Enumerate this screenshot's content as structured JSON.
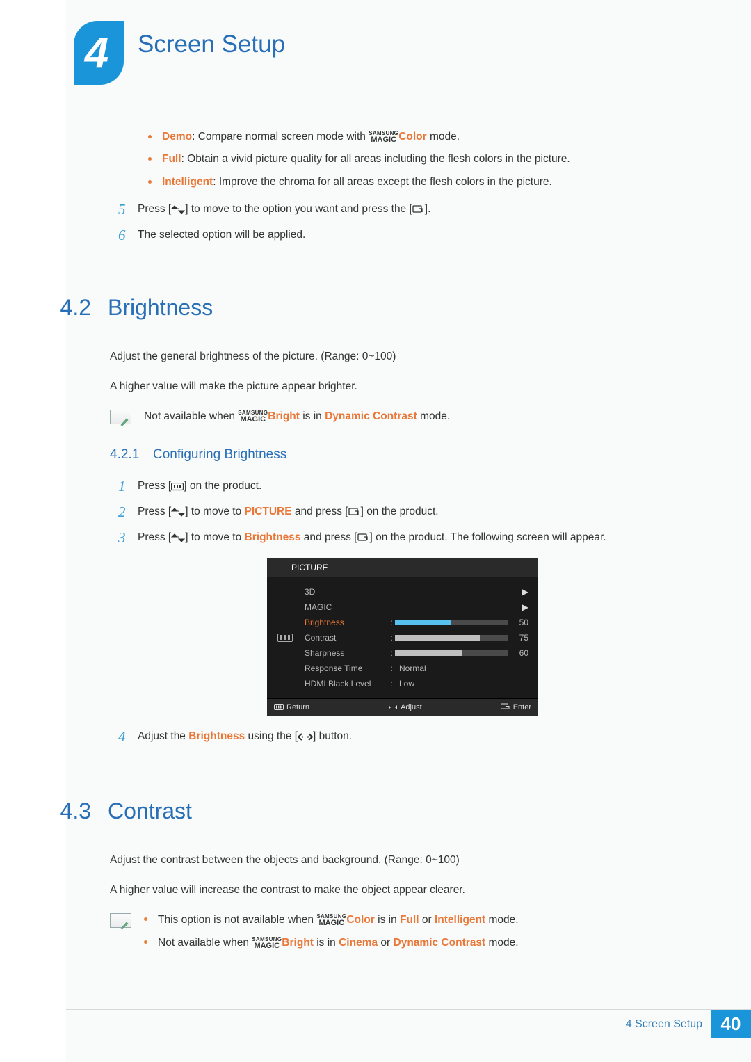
{
  "chapter": {
    "number": "4",
    "title": "Screen Setup"
  },
  "top_bullets": [
    {
      "label": "Demo",
      "text": ": Compare normal screen mode with ",
      "tail": " mode.",
      "magic": "Color"
    },
    {
      "label": "Full",
      "text": ": Obtain a vivid picture quality for all areas including the flesh colors in the picture."
    },
    {
      "label": "Intelligent",
      "text": ": Improve the chroma for all areas except the flesh colors in the picture."
    }
  ],
  "top_steps": [
    {
      "n": "5",
      "pre": "Press [",
      "mid": "] to move to the option you want and press the [",
      "post": "]."
    },
    {
      "n": "6",
      "txt": "The selected option will be applied."
    }
  ],
  "s42": {
    "num": "4.2",
    "title": "Brightness",
    "p1": "Adjust the general brightness of the picture. (Range: 0~100)",
    "p2": "A higher value will make the picture appear brighter.",
    "note_pre": "Not available when ",
    "note_magic": "Bright",
    "note_mid": " is in ",
    "note_mode": "Dynamic Contrast",
    "note_post": " mode.",
    "sub_num": "4.2.1",
    "sub_title": "Configuring Brightness",
    "steps": {
      "s1": {
        "n": "1",
        "pre": "Press [",
        "post": "] on the product."
      },
      "s2": {
        "n": "2",
        "pre": "Press [",
        "mid": "] to move to ",
        "kw": "PICTURE",
        "mid2": " and press [",
        "post": "] on the product."
      },
      "s3": {
        "n": "3",
        "pre": "Press [",
        "mid": "] to move to ",
        "kw": "Brightness",
        "mid2": " and press [",
        "post": "] on the product. The following screen will appear."
      },
      "s4": {
        "n": "4",
        "pre": "Adjust the ",
        "kw": "Brightness",
        "mid": " using the [",
        "post": "] button."
      }
    }
  },
  "osd": {
    "title": "PICTURE",
    "rows": [
      {
        "label": "3D",
        "type": "arrow"
      },
      {
        "label": "MAGIC",
        "type": "arrow"
      },
      {
        "label": "Brightness",
        "type": "bar",
        "value": 50,
        "selected": true
      },
      {
        "label": "Contrast",
        "type": "bar",
        "value": 75
      },
      {
        "label": "Sharpness",
        "type": "bar",
        "value": 60
      },
      {
        "label": "Response Time",
        "type": "text",
        "value": "Normal"
      },
      {
        "label": "HDMI Black Level",
        "type": "text",
        "value": "Low"
      }
    ],
    "foot": {
      "return": "Return",
      "adjust": "Adjust",
      "enter": "Enter"
    }
  },
  "s43": {
    "num": "4.3",
    "title": "Contrast",
    "p1": "Adjust the contrast between the objects and background. (Range: 0~100)",
    "p2": "A higher value will increase the contrast to make the object appear clearer.",
    "note1_pre": "This option is not available when ",
    "note1_magic": "Color",
    "note1_mid": " is in ",
    "note1_m1": "Full",
    "note1_or": " or ",
    "note1_m2": "Intelligent",
    "note1_post": " mode.",
    "note2_pre": "Not available when ",
    "note2_magic": "Bright",
    "note2_mid": " is in ",
    "note2_m1": "Cinema",
    "note2_or": " or ",
    "note2_m2": "Dynamic Contrast",
    "note2_post": " mode."
  },
  "footer": {
    "label": "4 Screen Setup",
    "page": "40"
  },
  "icons": {
    "magic_top": "SAMSUNG",
    "magic_bot": "MAGIC"
  }
}
